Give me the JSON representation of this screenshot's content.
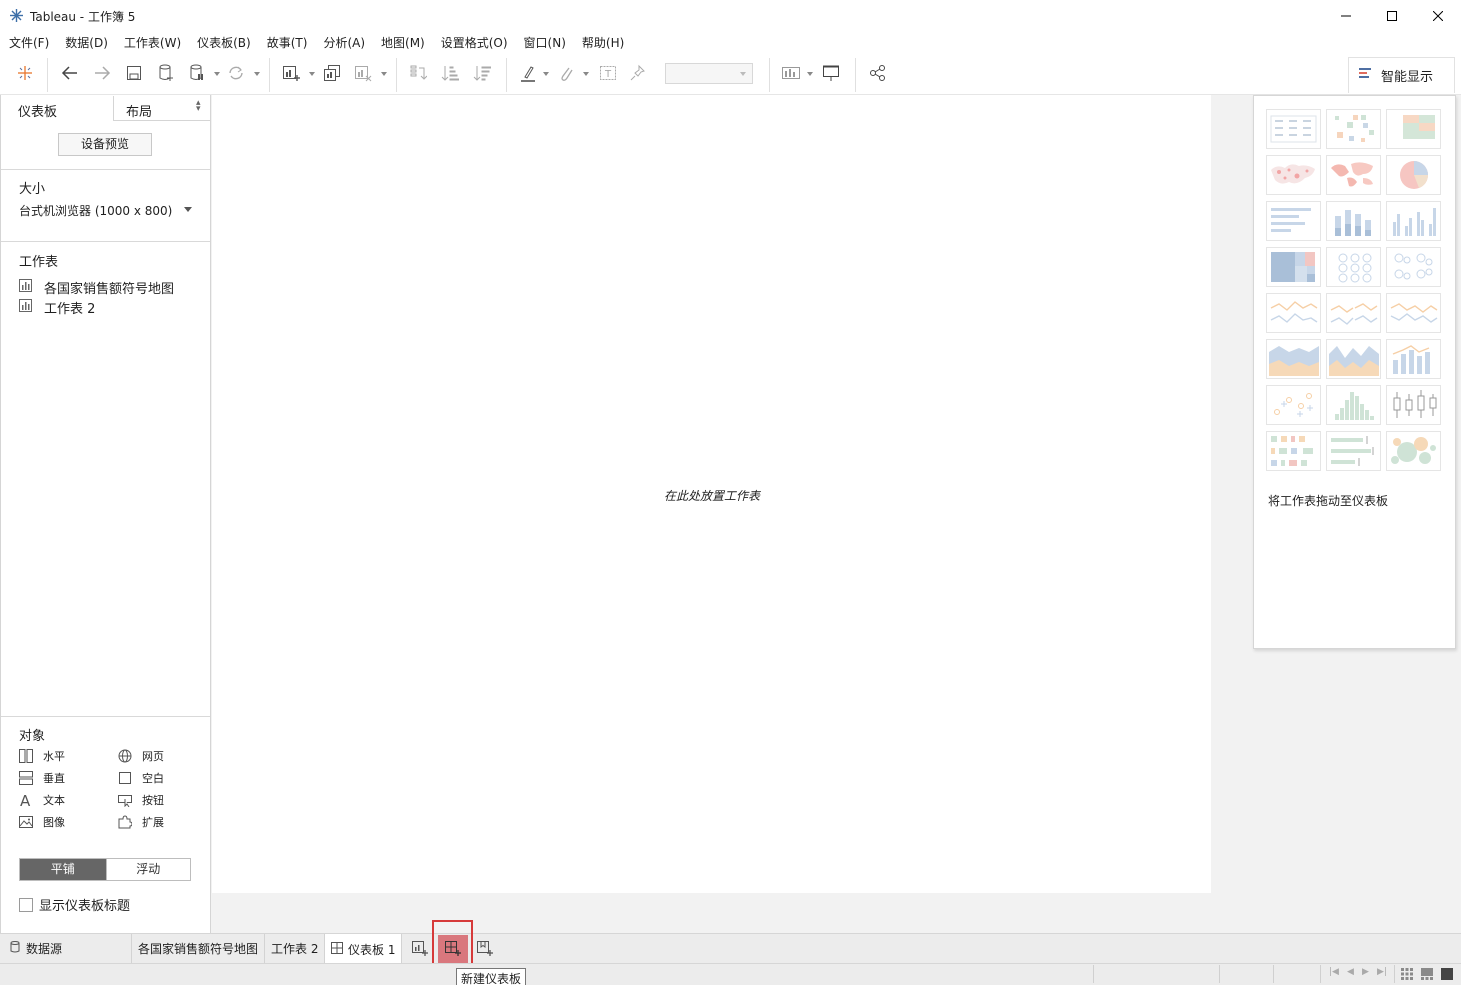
{
  "window": {
    "title": "Tableau - 工作簿 5"
  },
  "menu": [
    "文件(F)",
    "数据(D)",
    "工作表(W)",
    "仪表板(B)",
    "故事(T)",
    "分析(A)",
    "地图(M)",
    "设置格式(O)",
    "窗口(N)",
    "帮助(H)"
  ],
  "toolbar": {
    "show_me_label": "智能显示"
  },
  "left_panel": {
    "tab_dashboard": "仪表板",
    "tab_layout": "布局",
    "device_preview": "设备预览",
    "size_label": "大小",
    "size_value": "台式机浏览器 (1000 x 800)",
    "sheets_label": "工作表",
    "sheets": [
      "各国家销售额符号地图",
      "工作表 2"
    ],
    "objects_label": "对象",
    "objects": {
      "horizontal": "水平",
      "web": "网页",
      "vertical": "垂直",
      "blank": "空白",
      "text": "文本",
      "button": "按钮",
      "image": "图像",
      "extension": "扩展"
    },
    "tiled": "平铺",
    "floating": "浮动",
    "show_title": "显示仪表板标题"
  },
  "canvas": {
    "drop_hint": "在此处放置工作表"
  },
  "show_me": {
    "hint": "将工作表拖动至仪表板"
  },
  "bottom_tabs": {
    "data_source": "数据源",
    "sheet1": "各国家销售额符号地图",
    "sheet2": "工作表 2",
    "dashboard1": "仪表板 1"
  },
  "tooltip": "新建仪表板",
  "colors": {
    "accent_red": "#d63a3a",
    "new_dashboard_bg": "#d9777d",
    "tiled_bg": "#666666"
  }
}
